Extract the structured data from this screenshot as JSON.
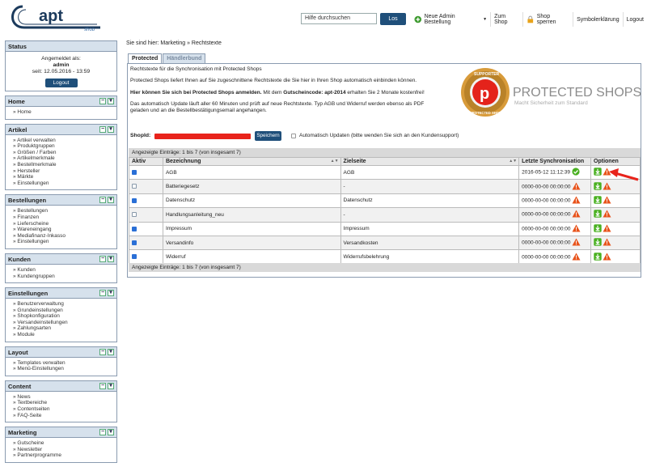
{
  "brand": {
    "logo_text": "apt",
    "logo_sub": "shop"
  },
  "search": {
    "placeholder": "Hilfe durchsuchen",
    "button_label": "Los"
  },
  "topnav": [
    "Neue Admin Bestellung",
    "Zum Shop",
    "Shop sperren",
    "Symbolerklärung",
    "Logout"
  ],
  "status": {
    "title": "Status",
    "line1": "Angemeldet als:",
    "user": "admin",
    "since": "seit: 12.05.2016 - 13:59",
    "logout": "Logout"
  },
  "sidebar": [
    {
      "title": "Home",
      "items": [
        "Home"
      ]
    },
    {
      "title": "Artikel",
      "items": [
        "Artikel verwalten",
        "Produktgruppen",
        "Größen / Farben",
        "Artikelmerkmale",
        "Bestellmerkmale",
        "Hersteller",
        "Märkte",
        "Einstellungen"
      ]
    },
    {
      "title": "Bestellungen",
      "items": [
        "Bestellungen",
        "Finanzen",
        "Lieferscheine",
        "Wareneingang",
        "Mediafinanz-Inkasso",
        "Einstellungen"
      ]
    },
    {
      "title": "Kunden",
      "items": [
        "Kunden",
        "Kundengruppen"
      ]
    },
    {
      "title": "Einstellungen",
      "items": [
        "Benutzerverwaltung",
        "Grundeinstellungen",
        "Shopkonfiguration",
        "Versandeinstellungen",
        "Zahlungsarten",
        "Module"
      ]
    },
    {
      "title": "Layout",
      "items": [
        "Templates verwalten",
        "Menü-Einstellungen"
      ]
    },
    {
      "title": "Content",
      "items": [
        "News",
        "Textbereiche",
        "Contentseiten",
        "FAQ-Seite"
      ]
    },
    {
      "title": "Marketing",
      "items": [
        "Gutscheine",
        "Newsletter",
        "Partnerprogramme"
      ]
    }
  ],
  "breadcrumb": "Sie sind hier: Marketing » Rechtstexte",
  "tabs": [
    "Protected",
    "Händlerbund"
  ],
  "panel": {
    "p1": "Rechtstexte für die Synchronisation mit Protected Shops",
    "p2": "Protected Shops liefert Ihnen auf Sie zugeschnittene Rechtstexte die Sie hier in Ihren Shop automatisch einbinden können.",
    "p3a": "Hier können Sie sich bei Protected Shops anmelden.",
    "p3b": " Mit dem ",
    "p3c": "Gutscheincode: apt-2014",
    "p3d": " erhalten Sie 2 Monate kostenfrei!",
    "p4": "Das automatisch Update läuft aller 60 Minuten und prüft auf neue Rechtstexte. Typ AGB und Widerruf werden ebenso als PDF",
    "p5": "geladen und an die Bestellbestätigungsemail angehangen.",
    "shopid_label": "ShopId:",
    "save_label": "Speichern",
    "auto_update": "Automatisch Updaten (bitte wenden Sie sich an den Kundensupport)",
    "ps_title": "PROTECTED SHOPS",
    "ps_sub": "Macht Sicherheit zum Standard",
    "seal_top": "SUPPORTER",
    "seal_bottom": "PROTECTED SHOPS"
  },
  "table": {
    "info": "Angezeigte Einträge: 1 bis 7 (von insgesamt 7)",
    "headers": [
      "Aktiv",
      "Bezeichnung",
      "Zielseite",
      "Letzte Synchronisation",
      "Optionen"
    ],
    "rows": [
      {
        "active": true,
        "name": "AGB",
        "target": "AGB",
        "sync": "2016-05-12 11:12:39",
        "ok": true
      },
      {
        "active": false,
        "name": "Batteriegesetz",
        "target": "-",
        "sync": "0000-00-00 00:00:00",
        "ok": false
      },
      {
        "active": true,
        "name": "Datenschutz",
        "target": "Datenschutz",
        "sync": "0000-00-00 00:00:00",
        "ok": false
      },
      {
        "active": false,
        "name": "Handlungsanleitung_neu",
        "target": "-",
        "sync": "0000-00-00 00:00:00",
        "ok": false
      },
      {
        "active": true,
        "name": "Impressum",
        "target": "Impressum",
        "sync": "0000-00-00 00:00:00",
        "ok": false
      },
      {
        "active": true,
        "name": "Versandinfo",
        "target": "Versandkosten",
        "sync": "0000-00-00 00:00:00",
        "ok": false
      },
      {
        "active": true,
        "name": "Widerruf",
        "target": "Widerrufsbelehrung",
        "sync": "0000-00-00 00:00:00",
        "ok": false
      }
    ]
  },
  "colors": {
    "accent": "#1f4f7a",
    "box_header": "#d6e1ec",
    "warn": "#e8531b",
    "ok": "#49b020"
  }
}
